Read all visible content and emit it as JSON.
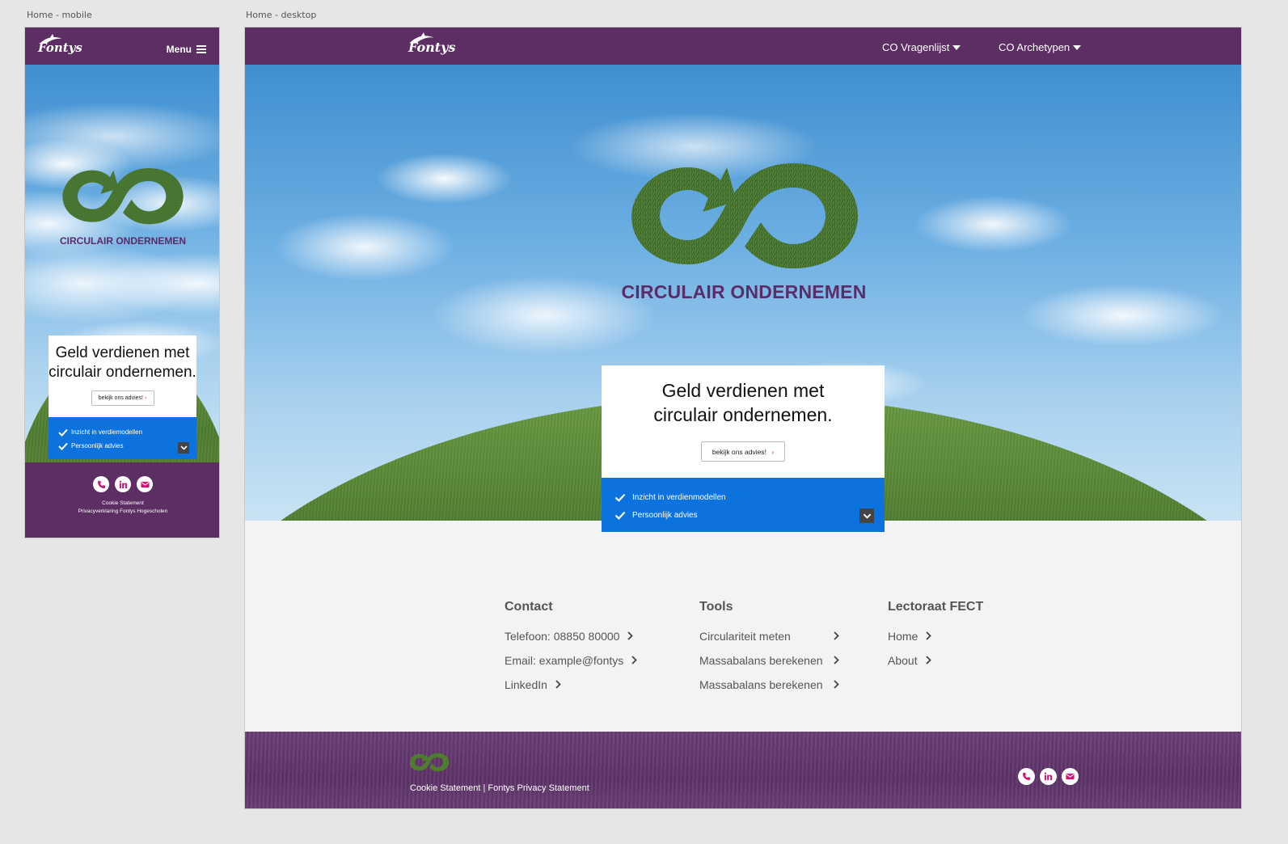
{
  "canvas_labels": {
    "mobile": "Home - mobile",
    "desktop": "Home - desktop"
  },
  "brand": {
    "name": "Fontys",
    "site_title": "CIRCULAIR ONDERNEMEN"
  },
  "colors": {
    "primary_purple": "#5d2e64",
    "accent_blue": "#0b72de",
    "title_purple": "#5a2c68",
    "icon_magenta": "#d1137a"
  },
  "mobile": {
    "menu_label": "Menu",
    "card": {
      "heading": "Geld verdienen met circulair ondernemen.",
      "cta": "bekijk ons advies!",
      "features": [
        "Inzicht in verdiemodellen",
        "Persoonlijk advies"
      ]
    },
    "footer": {
      "socials": [
        "phone-icon",
        "linkedin-icon",
        "mail-icon"
      ],
      "links": [
        "Cookie Statement",
        "Privacyverklaring Fontys Hogescholen"
      ]
    }
  },
  "desktop": {
    "nav": [
      {
        "label": "CO Vragenlijst"
      },
      {
        "label": "CO Archetypen"
      }
    ],
    "card": {
      "heading": "Geld verdienen met circulair ondernemen.",
      "cta": "bekijk ons advies!",
      "features": [
        "Inzicht in verdienmodellen",
        "Persoonlijk advies"
      ]
    },
    "footer_columns": [
      {
        "title": "Contact",
        "items": [
          "Telefoon: 08850 80000",
          "Email: example@fontys",
          "LinkedIn"
        ]
      },
      {
        "title": "Tools",
        "items": [
          "Circulariteit meten",
          "Massabalans berekenen",
          "Massabalans berekenen"
        ]
      },
      {
        "title": "Lectoraat FECT",
        "items": [
          "Home",
          "About"
        ]
      }
    ],
    "bottom": {
      "legal_left": "Cookie Statement",
      "separator": "|",
      "legal_right": "Fontys Privacy Statement",
      "socials": [
        "phone-icon",
        "linkedin-icon",
        "mail-icon"
      ]
    }
  }
}
